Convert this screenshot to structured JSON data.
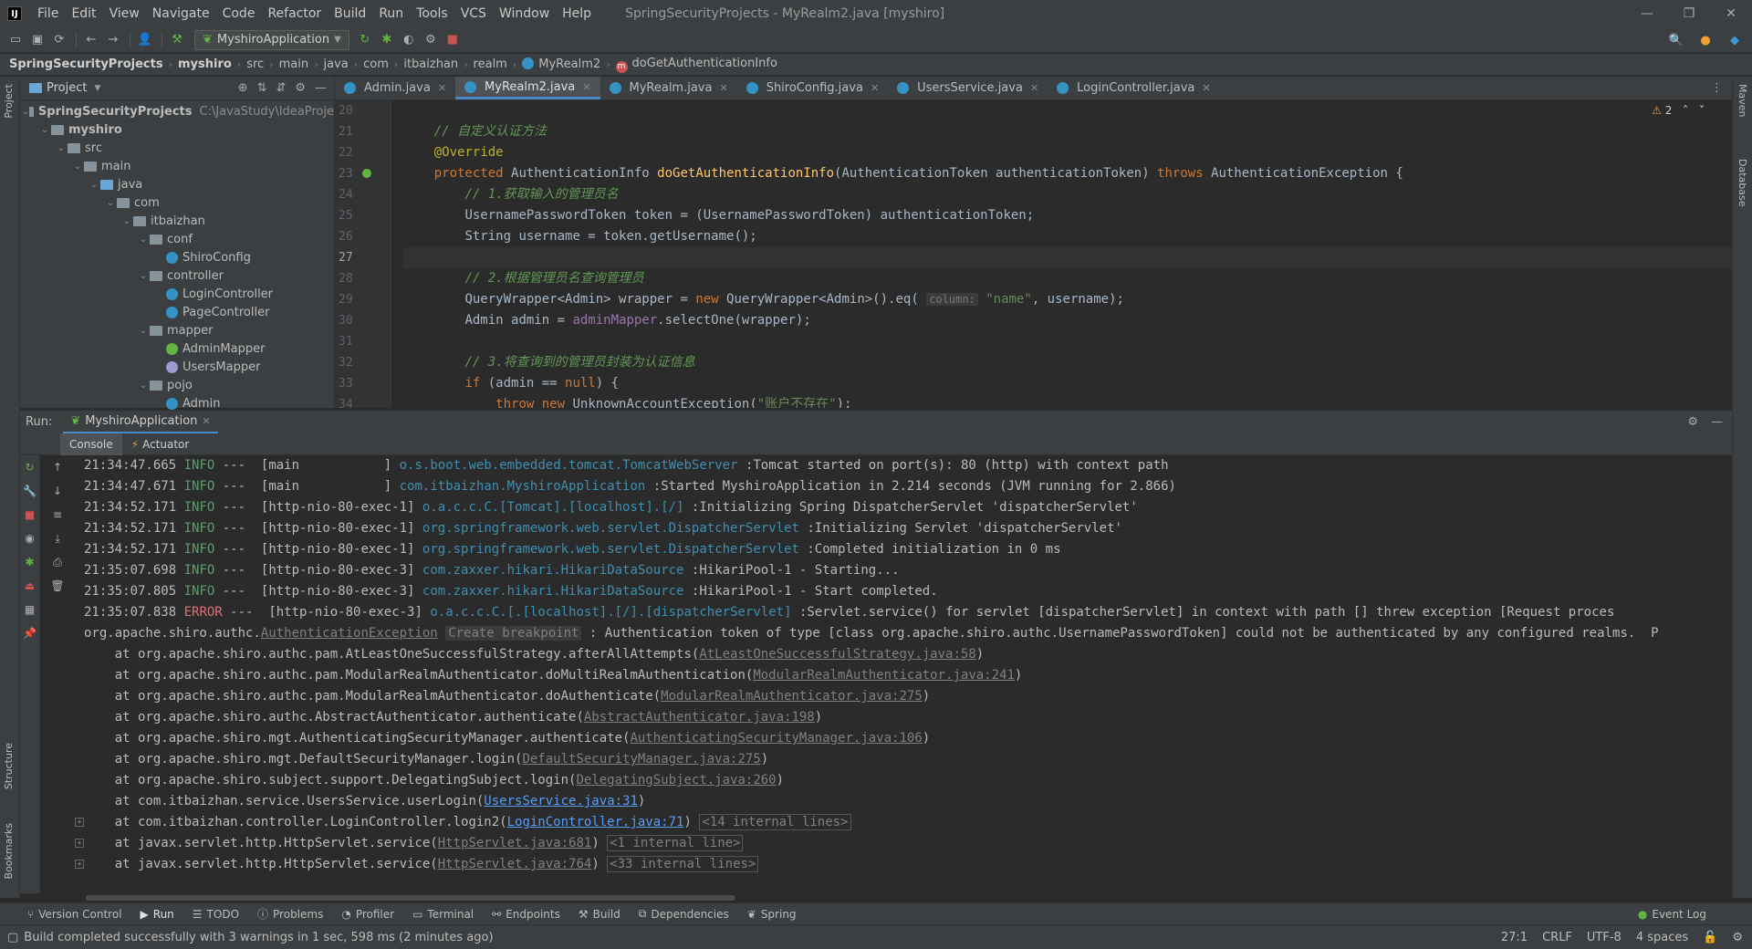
{
  "menu": {
    "items": [
      "File",
      "Edit",
      "View",
      "Navigate",
      "Code",
      "Refactor",
      "Build",
      "Run",
      "Tools",
      "VCS",
      "Window",
      "Help"
    ],
    "title": "SpringSecurityProjects - MyRealm2.java [myshiro]"
  },
  "toolbar": {
    "run_config": "MyshiroApplication"
  },
  "breadcrumb": [
    "SpringSecurityProjects",
    "myshiro",
    "src",
    "main",
    "java",
    "com",
    "itbaizhan",
    "realm",
    "MyRealm2",
    "doGetAuthenticationInfo"
  ],
  "side": {
    "project": "Project",
    "structure": "Structure",
    "bookmarks": "Bookmarks",
    "maven": "Maven",
    "database": "Database"
  },
  "project": {
    "label": "Project",
    "root_name": "SpringSecurityProjects",
    "root_path": "C:\\JavaStudy\\IdeaProje",
    "tree": [
      "myshiro",
      "src",
      "main",
      "java",
      "com",
      "itbaizhan",
      "conf",
      "ShiroConfig",
      "controller",
      "LoginController",
      "PageController",
      "mapper",
      "AdminMapper",
      "UsersMapper",
      "pojo",
      "Admin"
    ]
  },
  "tabs": [
    "Admin.java",
    "MyRealm2.java",
    "MyRealm.java",
    "ShiroConfig.java",
    "UsersService.java",
    "LoginController.java"
  ],
  "editor": {
    "line_numbers": [
      "20",
      "21",
      "22",
      "23",
      "24",
      "25",
      "26",
      "27",
      "28",
      "29",
      "30",
      "31",
      "32",
      "33",
      "34"
    ],
    "warnings": "2",
    "code": {
      "c21": "// 自定义认证方法",
      "c22": "@Override",
      "c23_kw": "protected",
      "c23_type": "AuthenticationInfo",
      "c23_fn": "doGetAuthenticationInfo",
      "c23_params": "(AuthenticationToken authenticationToken)",
      "c23_throws": "throws",
      "c23_exc": "AuthenticationException {",
      "c24": "// 1.获取输入的管理员名",
      "c25": "UsernamePasswordToken token = (UsernamePasswordToken) authenticationToken;",
      "c26": "String username = token.getUsername();",
      "c28": "// 2.根据管理员名查询管理员",
      "c29_a": "QueryWrapper<Admin> wrapper = ",
      "c29_new": "new",
      "c29_b": " QueryWrapper<Admin>().eq(",
      "c29_hint": "column:",
      "c29_str": "\"name\"",
      "c29_c": ", username);",
      "c30_a": "Admin admin = ",
      "c30_fld": "adminMapper",
      "c30_b": ".selectOne(wrapper);",
      "c32": "// 3.将查询到的管理员封装为认证信息",
      "c33_if": "if",
      "c33_a": " (admin == ",
      "c33_null": "null",
      "c33_b": ") {",
      "c34_throw": "throw",
      "c34_new": "new",
      "c34_a": " UnknownAccountException(",
      "c34_str": "\"账户不存在\"",
      "c34_b": ");"
    }
  },
  "run": {
    "label": "Run:",
    "config": "MyshiroApplication",
    "subtabs": [
      "Console",
      "Actuator"
    ],
    "log": [
      {
        "time": "21:34:47.665",
        "level": "INFO",
        "thread": "[main           ]",
        "logger": "o.s.boot.web.embedded.tomcat.TomcatWebServer",
        "msg": ":Tomcat started on port(s): 80 (http) with context path"
      },
      {
        "time": "21:34:47.671",
        "level": "INFO",
        "thread": "[main           ]",
        "logger": "com.itbaizhan.MyshiroApplication",
        "msg": ":Started MyshiroApplication in 2.214 seconds (JVM running for 2.866)"
      },
      {
        "time": "21:34:52.171",
        "level": "INFO",
        "thread": "[http-nio-80-exec-1]",
        "logger": "o.a.c.c.C.[Tomcat].[localhost].[/]",
        "msg": ":Initializing Spring DispatcherServlet 'dispatcherServlet'"
      },
      {
        "time": "21:34:52.171",
        "level": "INFO",
        "thread": "[http-nio-80-exec-1]",
        "logger": "org.springframework.web.servlet.DispatcherServlet",
        "msg": ":Initializing Servlet 'dispatcherServlet'"
      },
      {
        "time": "21:34:52.171",
        "level": "INFO",
        "thread": "[http-nio-80-exec-1]",
        "logger": "org.springframework.web.servlet.DispatcherServlet",
        "msg": ":Completed initialization in 0 ms"
      },
      {
        "time": "21:35:07.698",
        "level": "INFO",
        "thread": "[http-nio-80-exec-3]",
        "logger": "com.zaxxer.hikari.HikariDataSource",
        "msg": ":HikariPool-1 - Starting..."
      },
      {
        "time": "21:35:07.805",
        "level": "INFO",
        "thread": "[http-nio-80-exec-3]",
        "logger": "com.zaxxer.hikari.HikariDataSource",
        "msg": ":HikariPool-1 - Start completed."
      },
      {
        "time": "21:35:07.838",
        "level": "ERROR",
        "thread": "[http-nio-80-exec-3]",
        "logger": "o.a.c.c.C.[.[localhost].[/].[dispatcherServlet]",
        "msg": ":Servlet.service() for servlet [dispatcherServlet] in context with path [] threw exception [Request proces"
      }
    ],
    "exception": {
      "prefix": "org.apache.shiro.authc.",
      "name": "AuthenticationException",
      "breakpoint": "Create breakpoint",
      "message": " : Authentication token of type [class org.apache.shiro.authc.UsernamePasswordToken] could not be authenticated by any configured realms.  P"
    },
    "stack": [
      {
        "at": "at org.apache.shiro.authc.pam.AtLeastOneSuccessfulStrategy.afterAllAttempts(",
        "link": "AtLeastOneSuccessfulStrategy.java:58",
        "tail": ")",
        "internal": ""
      },
      {
        "at": "at org.apache.shiro.authc.pam.ModularRealmAuthenticator.doMultiRealmAuthentication(",
        "link": "ModularRealmAuthenticator.java:241",
        "tail": ")",
        "internal": ""
      },
      {
        "at": "at org.apache.shiro.authc.pam.ModularRealmAuthenticator.doAuthenticate(",
        "link": "ModularRealmAuthenticator.java:275",
        "tail": ")",
        "internal": ""
      },
      {
        "at": "at org.apache.shiro.authc.AbstractAuthenticator.authenticate(",
        "link": "AbstractAuthenticator.java:198",
        "tail": ")",
        "internal": ""
      },
      {
        "at": "at org.apache.shiro.mgt.AuthenticatingSecurityManager.authenticate(",
        "link": "AuthenticatingSecurityManager.java:106",
        "tail": ")",
        "internal": ""
      },
      {
        "at": "at org.apache.shiro.mgt.DefaultSecurityManager.login(",
        "link": "DefaultSecurityManager.java:275",
        "tail": ")",
        "internal": ""
      },
      {
        "at": "at org.apache.shiro.subject.support.DelegatingSubject.login(",
        "link": "DelegatingSubject.java:260",
        "tail": ")",
        "internal": ""
      },
      {
        "at": "at com.itbaizhan.service.UsersService.userLogin(",
        "link": "UsersService.java:31",
        "tail": ")",
        "internal": "",
        "user": true
      },
      {
        "at": "at com.itbaizhan.controller.LoginController.login2(",
        "link": "LoginController.java:71",
        "tail": ")",
        "internal": "<14 internal lines>",
        "user": true
      },
      {
        "at": "at javax.servlet.http.HttpServlet.service(",
        "link": "HttpServlet.java:681",
        "tail": ")",
        "internal": "<1 internal line>"
      },
      {
        "at": "at javax.servlet.http.HttpServlet.service(",
        "link": "HttpServlet.java:764",
        "tail": ")",
        "internal": "<33 internal lines>"
      }
    ]
  },
  "bottom_tools": [
    "Version Control",
    "Run",
    "TODO",
    "Problems",
    "Profiler",
    "Terminal",
    "Endpoints",
    "Build",
    "Dependencies",
    "Spring"
  ],
  "event_log": "Event Log",
  "status": {
    "message": "Build completed successfully with 3 warnings in 1 sec, 598 ms (2 minutes ago)",
    "position": "27:1",
    "line_sep": "CRLF",
    "encoding": "UTF-8",
    "indent": "4 spaces"
  },
  "colors": {
    "accent": "#4a88c7",
    "error": "#e06c75",
    "link": "#589df6",
    "comment": "#629755",
    "keyword": "#cc7832"
  }
}
